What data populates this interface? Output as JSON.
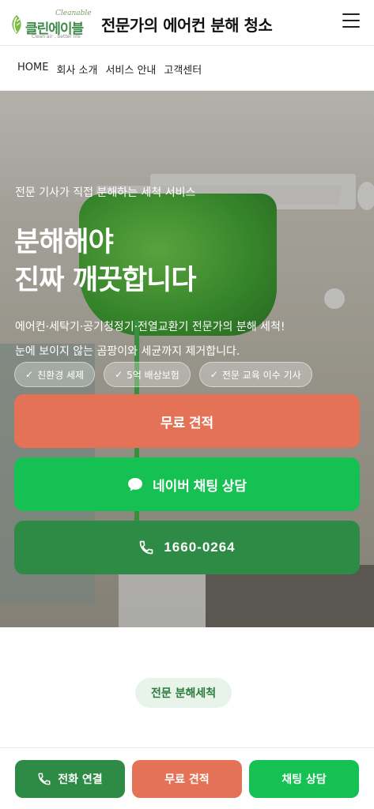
{
  "header": {
    "logo_text": "클린에이블",
    "logo_en": "Cleanable",
    "logo_slogan": "Clean air , better life",
    "title": "전문가의 에어컨 분해 청소",
    "menu_icon": "hamburger-menu-icon"
  },
  "nav": {
    "items": [
      {
        "label": "HOME"
      },
      {
        "label": "회사 소개"
      },
      {
        "label": "서비스 안내"
      },
      {
        "label": "고객센터"
      }
    ]
  },
  "hero": {
    "eyebrow": "전문 기사가 직접 분해하는 세척 서비스",
    "headline_line1": "분해해야",
    "headline_line2": "진짜 깨끗합니다",
    "sub_line1": "에어컨·세탁기·공기청정기·전열교환기 전문가의 분해 세척!",
    "sub_line2": "눈에 보이지 않는 곰팡이와 세균까지 제거합니다.",
    "badges": [
      {
        "label": "친환경 세제",
        "icon": "check-icon"
      },
      {
        "label": "5억 배상보험",
        "icon": "check-icon"
      },
      {
        "label": "전문 교육 이수 기사",
        "icon": "check-icon"
      }
    ],
    "buttons": {
      "quote": "무료 견적",
      "naver": "네이버 채팅 상담",
      "phone": "1660-0264"
    }
  },
  "section": {
    "tag": "전문 분해세척"
  },
  "bottom_bar": {
    "call": "전화 연결",
    "quote": "무료 견적",
    "chat": "채팅 상담"
  },
  "colors": {
    "brand_green": "#2e8b45",
    "naver_green": "#14c152",
    "quote_orange": "#e47257",
    "tag_bg": "#e8f3ea"
  }
}
